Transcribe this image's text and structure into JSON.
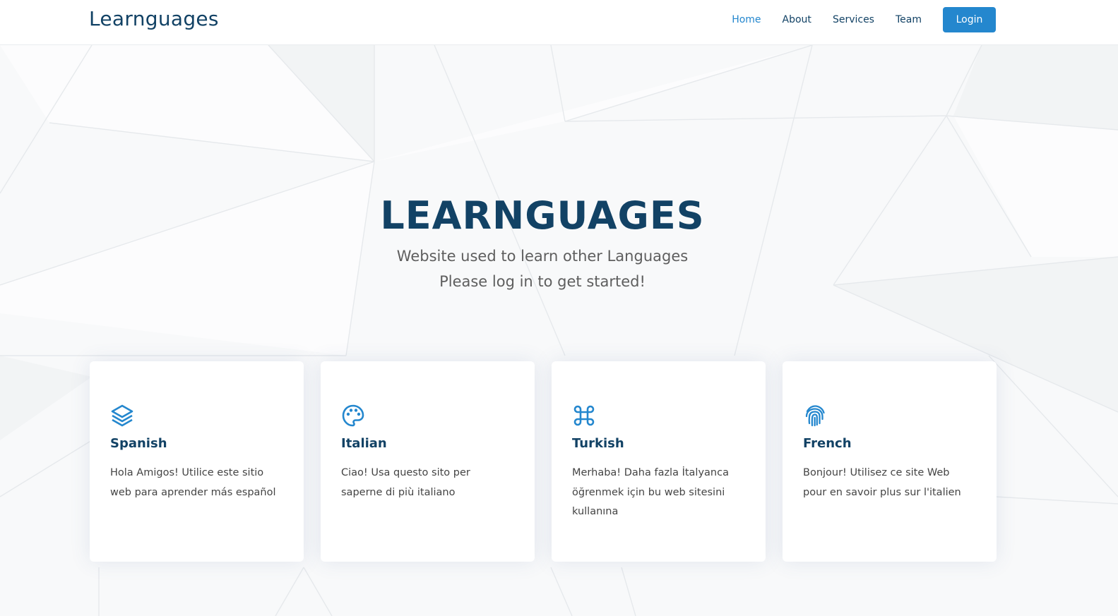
{
  "header": {
    "logo": "Learnguages",
    "nav": {
      "home": "Home",
      "about": "About",
      "services": "Services",
      "team": "Team",
      "login": "Login"
    }
  },
  "hero": {
    "title": "LEARNGUAGES",
    "subtitle_line1": "Website used to learn other Languages",
    "subtitle_line2": "Please log in to get started!"
  },
  "cards": [
    {
      "icon": "layers-icon",
      "title": "Spanish",
      "text": "Hola Amigos! Utilice este sitio web para aprender más español"
    },
    {
      "icon": "palette-icon",
      "title": "Italian",
      "text": "Ciao! Usa questo sito per saperne di più italiano"
    },
    {
      "icon": "command-icon",
      "title": "Turkish",
      "text": "Merhaba! Daha fazla İtalyanca öğrenmek için bu web sitesini kullanına"
    },
    {
      "icon": "fingerprint-icon",
      "title": "French",
      "text": "Bonjour! Utilisez ce site Web pour en savoir plus sur l'italien"
    }
  ],
  "colors": {
    "primary": "#2487ce",
    "heading": "#124265",
    "text": "#444444",
    "hero_bg": "#f8f9fa"
  }
}
